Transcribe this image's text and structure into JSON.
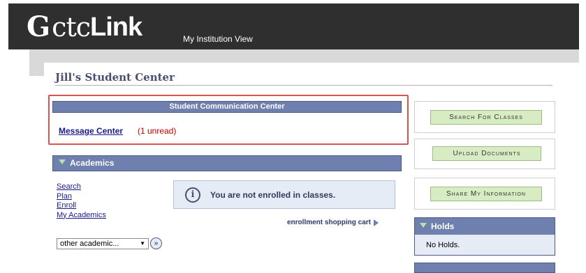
{
  "header": {
    "logo_mark": "G",
    "logo_ctc": "ctc",
    "logo_link": "Link",
    "institution_view": "My Institution View"
  },
  "page": {
    "title": "Jill's Student Center"
  },
  "communication": {
    "title": "Student Communication Center",
    "message_center": "Message Center",
    "unread": "(1 unread)"
  },
  "academics": {
    "title": "Academics",
    "links": [
      "Search",
      "Plan",
      "Enroll",
      "My Academics"
    ],
    "notice": "You are not enrolled in classes.",
    "cart": "enrollment shopping cart",
    "other_select": "other academic..."
  },
  "sidebar": {
    "search_classes": "Search For Classes",
    "upload_documents": "Upload Documents",
    "share_info": "Share My Information",
    "holds_title": "Holds",
    "holds_text": "No Holds."
  },
  "colors": {
    "header_dark": "#2f2f2f",
    "section_bar": "#6f7fae",
    "highlight_border": "#d9534f",
    "green_button": "#d8ecc4",
    "link_blue": "#1a1a8c",
    "unread_red": "#c00000"
  }
}
